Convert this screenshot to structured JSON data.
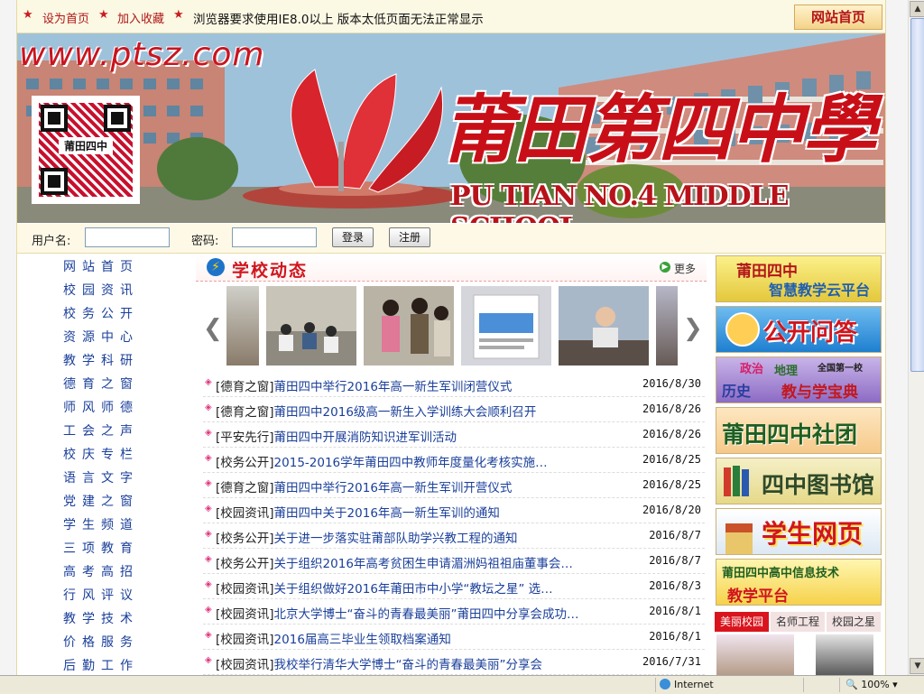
{
  "topbar": {
    "set_home": "设为首页",
    "add_fav": "加入收藏",
    "notice": "浏览器要求使用IE8.0以上 版本太低页面无法正常显示",
    "site_home": "网站首页"
  },
  "banner": {
    "url": "www.ptsz.com",
    "school_name_cn": "莆田第四中學",
    "school_name_en": "PU TIAN NO.4 MIDDLE SCHOOL",
    "qr_label": "莆田四中"
  },
  "login": {
    "username_label": "用户名:",
    "password_label": "密码:",
    "login_btn": "登录",
    "register_btn": "注册"
  },
  "nav": {
    "items": [
      "网站首页",
      "校园资讯",
      "校务公开",
      "资源中心",
      "教学科研",
      "德育之窗",
      "师风师德",
      "工会之声",
      "校庆专栏",
      "语言文字",
      "党建之窗",
      "学生频道",
      "三项教育",
      "高考高招",
      "行风评议",
      "教学技术",
      "价格服务",
      "后勤工作"
    ]
  },
  "news": {
    "title": "学校动态",
    "more": "更多",
    "items": [
      {
        "cat": "[德育之窗]",
        "title": "莆田四中举行2016年高一新生军训闭营仪式",
        "date": "2016/8/30"
      },
      {
        "cat": "[德育之窗]",
        "title": "莆田四中2016级高一新生入学训练大会顺利召开",
        "date": "2016/8/26"
      },
      {
        "cat": "[平安先行]",
        "title": "莆田四中开展消防知识进军训活动",
        "date": "2016/8/26"
      },
      {
        "cat": "[校务公开]",
        "title": "2015-2016学年莆田四中教师年度量化考核实施…",
        "date": "2016/8/25"
      },
      {
        "cat": "[德育之窗]",
        "title": "莆田四中举行2016年高一新生军训开营仪式",
        "date": "2016/8/25"
      },
      {
        "cat": "[校园资讯]",
        "title": "莆田四中关于2016年高一新生军训的通知",
        "date": "2016/8/20"
      },
      {
        "cat": "[校务公开]",
        "title": "关于进一步落实驻莆部队助学兴教工程的通知",
        "date": "2016/8/7"
      },
      {
        "cat": "[校务公开]",
        "title": "关于组织2016年高考贫困生申请湄洲妈祖祖庙董事会…",
        "date": "2016/8/7"
      },
      {
        "cat": "[校园资讯]",
        "title": "关于组织做好2016年莆田市中小学“教坛之星” 选…",
        "date": "2016/8/3"
      },
      {
        "cat": "[校园资讯]",
        "title": "北京大学博士“奋斗的青春最美丽”莆田四中分享会成功…",
        "date": "2016/8/1"
      },
      {
        "cat": "[校园资讯]",
        "title": "2016届高三毕业生领取档案通知",
        "date": "2016/8/1"
      },
      {
        "cat": "[校园资讯]",
        "title": "我校举行清华大学博士“奋斗的青春最美丽”分享会",
        "date": "2016/7/31"
      }
    ]
  },
  "side": {
    "cloud_line1": "莆田四中",
    "cloud_line2": "智慧教学云平台",
    "qa": "公开问答",
    "treasure_a": "政治",
    "treasure_b": "地理",
    "treasure_c": "历史",
    "treasure_d": "全国第一校",
    "treasure_main": "教与学宝典",
    "clubs": "莆田四中社团",
    "library": "四中图书馆",
    "student_page": "学生网页",
    "it_line1": "莆田四中高中信息技术",
    "it_line2": "教学平台",
    "tabs": [
      "美丽校园",
      "名师工程",
      "校园之星"
    ]
  },
  "statusbar": {
    "zone": "Internet",
    "zoom": "100%"
  },
  "colors": {
    "brand_red": "#c80f18",
    "link_blue": "#1a3f9a",
    "tab_active": "#d9141c"
  }
}
